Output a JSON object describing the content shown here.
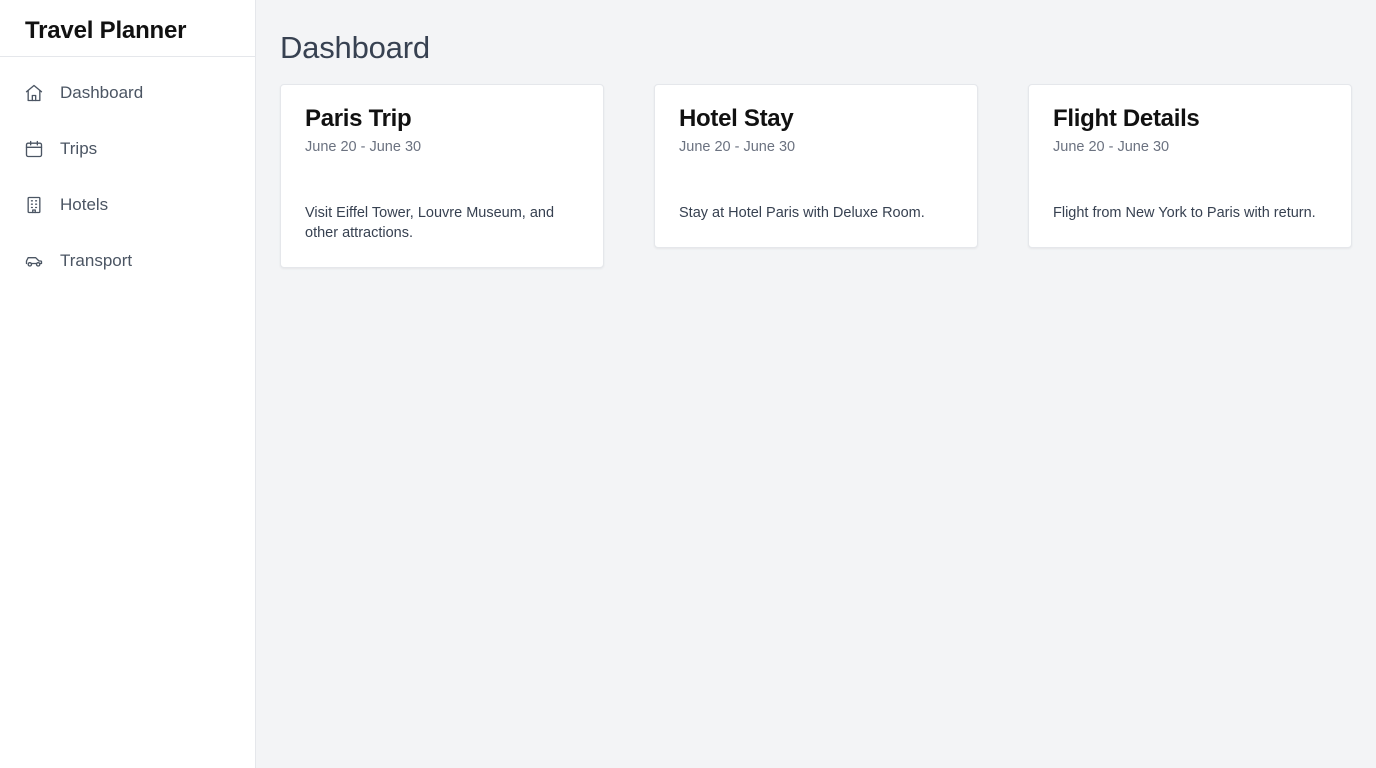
{
  "sidebar": {
    "brand": "Travel Planner",
    "items": [
      {
        "label": "Dashboard",
        "icon": "home-icon"
      },
      {
        "label": "Trips",
        "icon": "calendar-icon"
      },
      {
        "label": "Hotels",
        "icon": "building-icon"
      },
      {
        "label": "Transport",
        "icon": "car-icon"
      }
    ]
  },
  "main": {
    "title": "Dashboard",
    "cards": [
      {
        "title": "Paris Trip",
        "dates": "June 20 - June 30",
        "description": "Visit Eiffel Tower, Louvre Museum, and other attractions."
      },
      {
        "title": "Hotel Stay",
        "dates": "June 20 - June 30",
        "description": "Stay at Hotel Paris with Deluxe Room."
      },
      {
        "title": "Flight Details",
        "dates": "June 20 - June 30",
        "description": "Flight from New York to Paris with return."
      }
    ]
  },
  "colors": {
    "background": "#f3f4f6",
    "sidebar": "#ffffff",
    "text_primary": "#111111",
    "text_muted": "#6b7280"
  }
}
